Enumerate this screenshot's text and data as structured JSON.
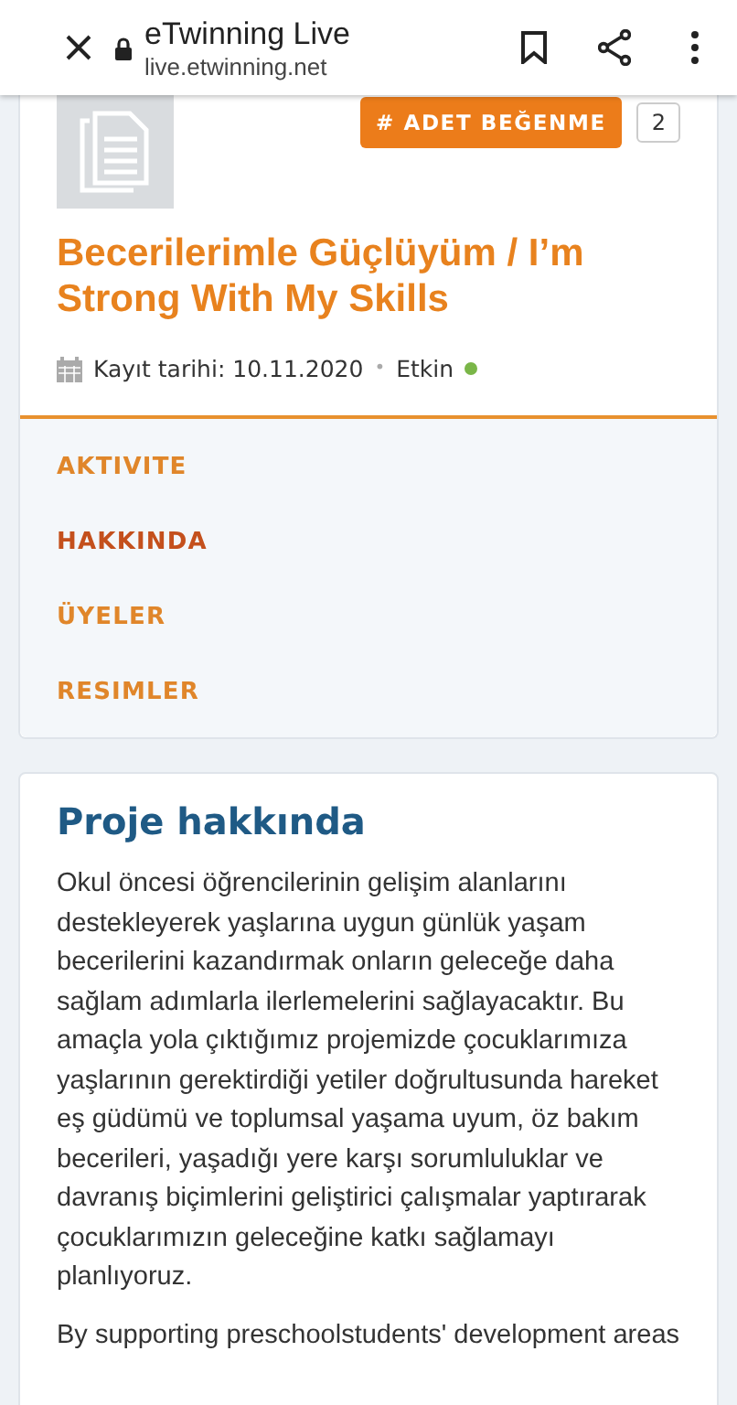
{
  "browser_bar": {
    "title": "eTwinning Live",
    "url": "live.etwinning.net"
  },
  "project": {
    "like_button": "# ADET BEĞENME",
    "like_count": "2",
    "title": "Becerilerimle Güçlüyüm / I’m Strong With My Skills",
    "registered": "Kayıt tarihi: 10.11.2020",
    "separator": "•",
    "status": {
      "label": "Etkin",
      "color": "#7ab648"
    }
  },
  "nav": [
    {
      "label": "AKTIVITE",
      "selected": false
    },
    {
      "label": "HAKKINDA",
      "selected": true
    },
    {
      "label": "ÜYELER",
      "selected": false
    },
    {
      "label": "RESIMLER",
      "selected": false
    }
  ],
  "about": {
    "heading": "Proje hakkında",
    "paragraphs": [
      "Okul öncesi öğrencilerinin gelişim alanlarını destekleyerek yaşlarına uygun günlük yaşam becerilerini kazandırmak onların geleceğe daha sağlam adımlarla ilerlemelerini sağlayacaktır. Bu amaçla yola çıktığımız projemizde çocuklarımıza yaşlarının gerektirdiği yetiler doğrultusunda hareket eş güdümü ve toplumsal yaşama uyum, öz bakım becerileri, yaşadığı yere karşı sorumluluklar ve davranış biçimlerini geliştirici çalışmalar yaptırarak çocuklarımızın geleceğine katkı sağlamayı planlıyoruz.",
      "By supporting preschoolstudents' development areas"
    ]
  }
}
